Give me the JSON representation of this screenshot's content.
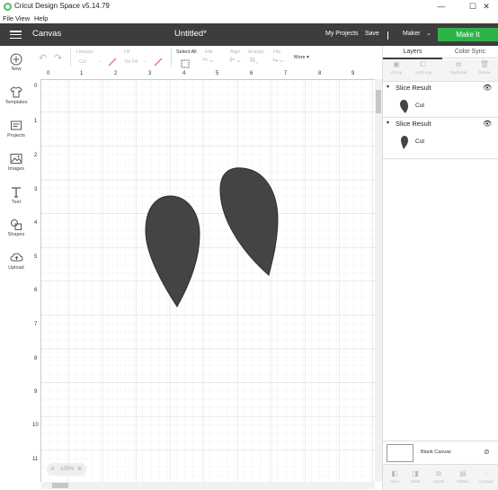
{
  "window": {
    "title": "Cricut Design Space  v5.14.79",
    "controls": [
      "—",
      "☐",
      "✕"
    ]
  },
  "menu": [
    "File",
    "View",
    "Help"
  ],
  "header": {
    "section": "Canvas",
    "document_title": "Untitled*",
    "my_projects": "My Projects",
    "save": "Save",
    "machine": "Maker",
    "make_it": "Make It"
  },
  "toolbar": {
    "linetype_label": "Linetype",
    "linetype_value": "Cut",
    "fill_label": "Fill",
    "fill_value": "No Fill",
    "select_all": "Select All",
    "edit": "Edit",
    "align": "Align",
    "arrange": "Arrange",
    "flip": "Flip",
    "more": "More"
  },
  "sidebar": [
    {
      "label": "New",
      "icon": "plus-icon"
    },
    {
      "label": "Templates",
      "icon": "shirt-icon"
    },
    {
      "label": "Projects",
      "icon": "folder-icon"
    },
    {
      "label": "Images",
      "icon": "image-icon"
    },
    {
      "label": "Text",
      "icon": "text-icon"
    },
    {
      "label": "Shapes",
      "icon": "shapes-icon"
    },
    {
      "label": "Upload",
      "icon": "cloud-upload-icon"
    }
  ],
  "rulers": {
    "top": [
      "0",
      "1",
      "2",
      "3",
      "4",
      "5",
      "6",
      "7",
      "8",
      "9"
    ],
    "left": [
      "0",
      "1",
      "2",
      "3",
      "4",
      "5",
      "6",
      "7",
      "8",
      "9",
      "10",
      "11"
    ]
  },
  "zoom": "100%",
  "panel": {
    "tabs": [
      "Layers",
      "Color Sync"
    ],
    "actions": [
      "Group",
      "UnGroup",
      "Duplicate",
      "Delete"
    ],
    "groups": [
      {
        "name": "Slice Result",
        "layer": "Cut"
      },
      {
        "name": "Slice Result",
        "layer": "Cut"
      }
    ],
    "blank_canvas": "Blank Canvas",
    "bottom_actions": [
      "Slice",
      "Weld",
      "Attach",
      "Flatten",
      "Contour"
    ]
  },
  "colors": {
    "header": "#3d3d3d",
    "make_it": "#2db34a",
    "shape_fill": "#444444"
  }
}
